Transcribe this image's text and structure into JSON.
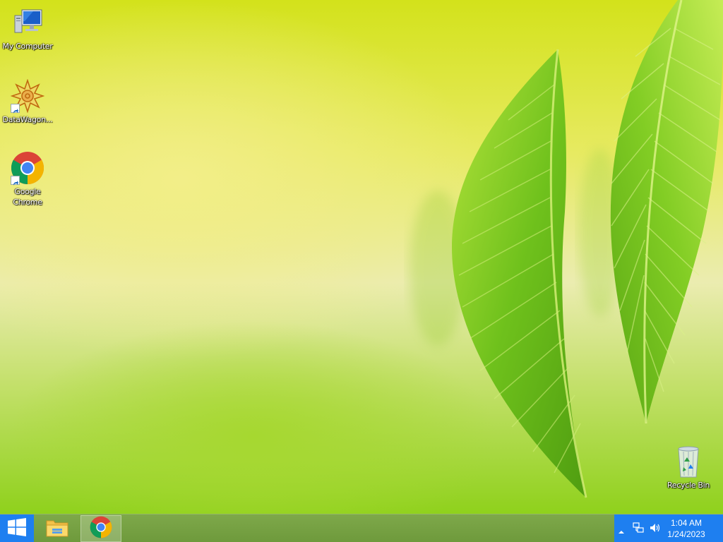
{
  "desktop": {
    "icons": [
      {
        "label": "My Computer",
        "icon": "computer-icon"
      },
      {
        "label": "DataWagon...",
        "icon": "datawagon-icon",
        "shortcut": true
      },
      {
        "label": "Google Chrome",
        "icon": "chrome-icon",
        "shortcut": true
      },
      {
        "label": "Recycle Bin",
        "icon": "recycle-bin-icon"
      }
    ]
  },
  "taskbar": {
    "start_icon": "windows-logo-icon",
    "pinned": [
      {
        "name": "File Explorer",
        "icon": "file-explorer-icon"
      },
      {
        "name": "Google Chrome",
        "icon": "chrome-icon",
        "active": true
      }
    ],
    "tray": {
      "icons": [
        "show-hidden-icons-arrow",
        "network-icon",
        "volume-icon"
      ],
      "time": "1:04 AM",
      "date": "1/24/2023"
    }
  },
  "colors": {
    "taskbar": "#7ea84a",
    "start_button": "#1e7ff0",
    "tray_background": "#1e7ff0"
  }
}
